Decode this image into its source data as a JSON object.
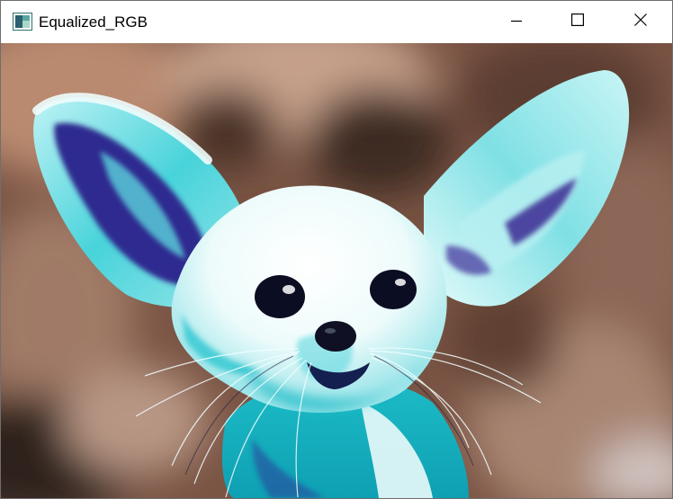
{
  "window": {
    "title": "Equalized_RGB",
    "controls": {
      "minimize": "minimize-icon",
      "maximize": "maximize-icon",
      "close": "close-icon"
    }
  },
  "image": {
    "subject": "fennec-fox",
    "palette": {
      "background_warm": "#8a5e48",
      "background_dark": "#3e2a22",
      "fur_white": "#f4fbfb",
      "fur_cyan": "#27c6cf",
      "ear_inner_purple": "#3a2f92",
      "eye_dark": "#0b0d22"
    }
  }
}
